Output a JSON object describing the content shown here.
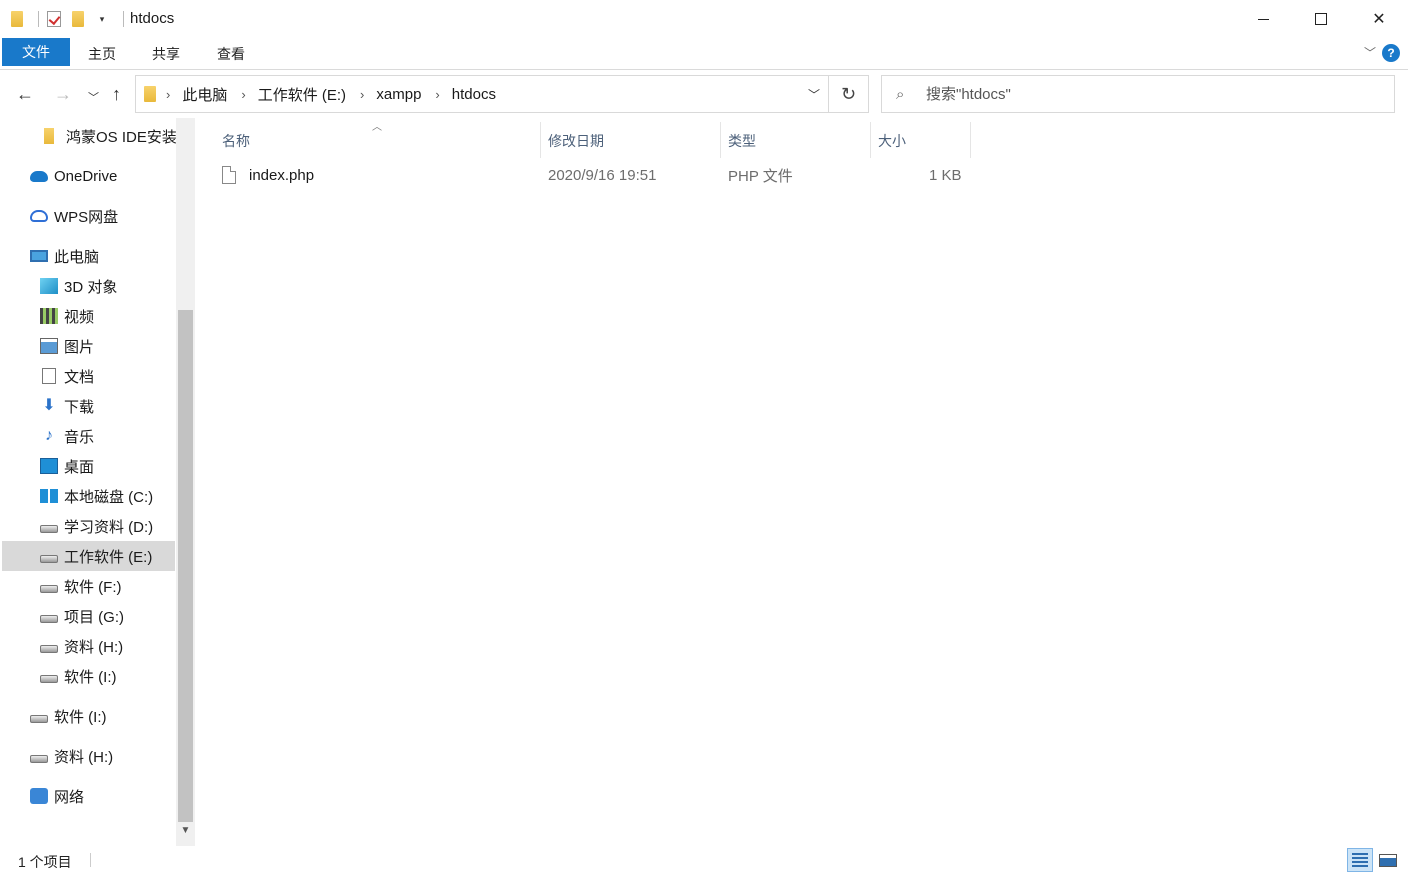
{
  "window": {
    "title": "htdocs",
    "minimize_label": "",
    "maximize_label": "",
    "close_label": "✕"
  },
  "ribbon": {
    "tabs": [
      "文件",
      "主页",
      "共享",
      "查看"
    ],
    "help_label": "?"
  },
  "address": {
    "crumbs": [
      "此电脑",
      "工作软件 (E:)",
      "xampp",
      "htdocs"
    ]
  },
  "search": {
    "placeholder": "搜索\"htdocs\""
  },
  "sidebar": {
    "items": [
      {
        "label": "鸿蒙OS IDE安装",
        "icon": "folder-icon"
      },
      {
        "label": "OneDrive",
        "icon": "onedrive-icon"
      },
      {
        "label": "WPS网盘",
        "icon": "cloud-icon"
      },
      {
        "label": "此电脑",
        "icon": "computer-icon"
      },
      {
        "label": "3D 对象",
        "icon": "3d-objects-icon"
      },
      {
        "label": "视频",
        "icon": "video-icon"
      },
      {
        "label": "图片",
        "icon": "pictures-icon"
      },
      {
        "label": "文档",
        "icon": "documents-icon"
      },
      {
        "label": "下载",
        "icon": "downloads-icon"
      },
      {
        "label": "音乐",
        "icon": "music-icon"
      },
      {
        "label": "桌面",
        "icon": "desktop-icon"
      },
      {
        "label": "本地磁盘 (C:)",
        "icon": "windows-drive-icon"
      },
      {
        "label": "学习资料 (D:)",
        "icon": "drive-icon"
      },
      {
        "label": "工作软件 (E:)",
        "icon": "drive-icon"
      },
      {
        "label": "软件 (F:)",
        "icon": "drive-icon"
      },
      {
        "label": "项目 (G:)",
        "icon": "drive-icon"
      },
      {
        "label": "资料 (H:)",
        "icon": "drive-icon"
      },
      {
        "label": "软件 (I:)",
        "icon": "drive-icon"
      },
      {
        "label": "软件 (I:)",
        "icon": "drive-icon"
      },
      {
        "label": "资料 (H:)",
        "icon": "drive-icon"
      },
      {
        "label": "网络",
        "icon": "network-icon"
      }
    ],
    "selected_index": 13
  },
  "file_list": {
    "columns": [
      "名称",
      "修改日期",
      "类型",
      "大小"
    ],
    "rows": [
      {
        "name": "index.php",
        "modified": "2020/9/16 19:51",
        "type": "PHP 文件",
        "size": "1 KB"
      }
    ]
  },
  "status": {
    "count": "1 个项目"
  },
  "colors": {
    "accent": "#1979ca",
    "selected_bg": "#d9d9d9"
  }
}
